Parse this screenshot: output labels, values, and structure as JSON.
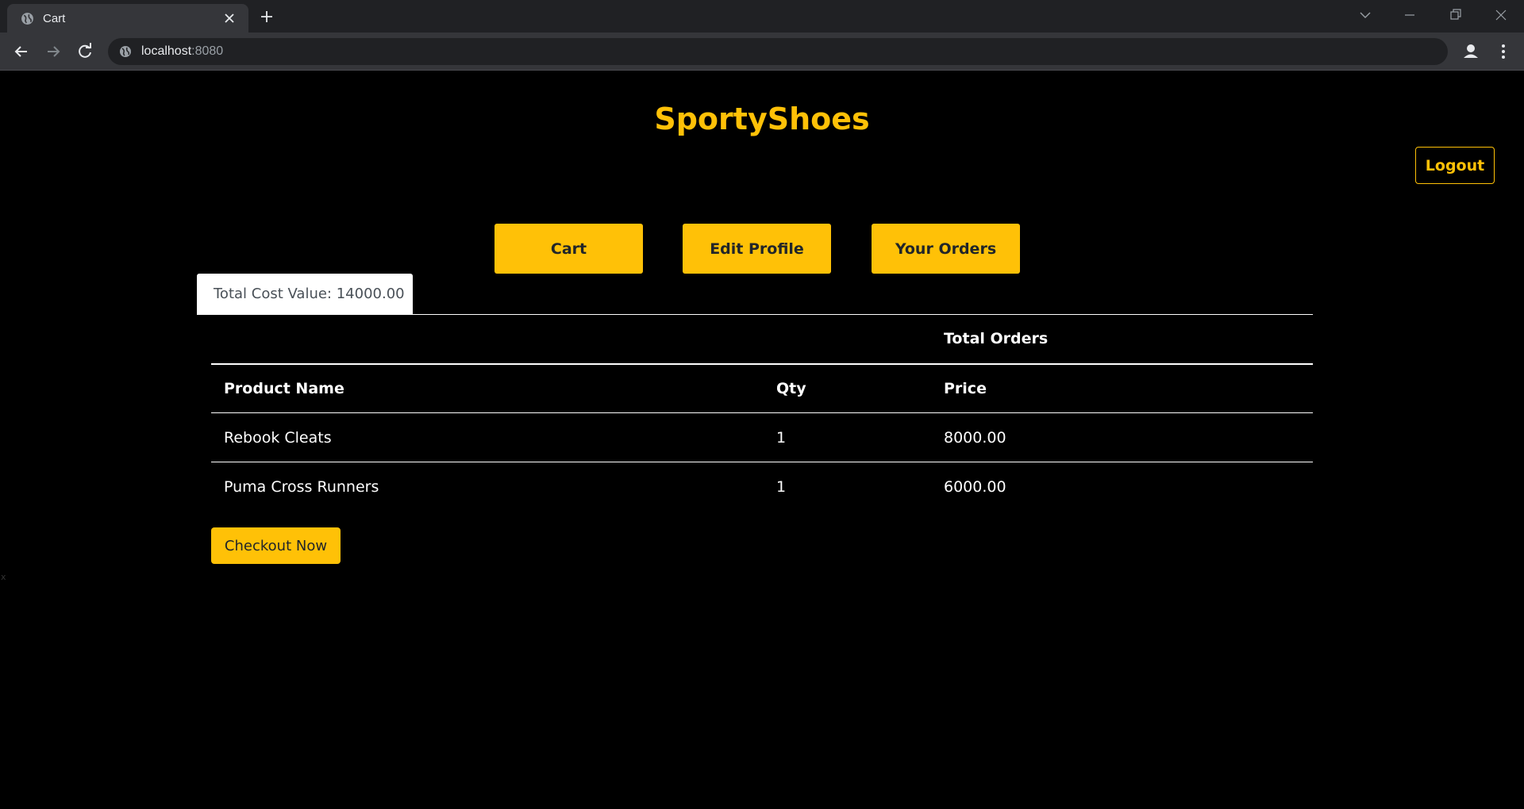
{
  "browser": {
    "tab_title": "Cart",
    "url_host": "localhost",
    "url_port": ":8080"
  },
  "header": {
    "brand": "SportyShoes",
    "logout_label": "Logout"
  },
  "nav": {
    "cart_label": "Cart",
    "edit_profile_label": "Edit Profile",
    "your_orders_label": "Your Orders"
  },
  "summary": {
    "total_cost": "Total Cost Value: 14000.00"
  },
  "table": {
    "group_header": "Total Orders",
    "columns": [
      "Product Name",
      "Qty",
      "Price"
    ],
    "rows": [
      {
        "name": "Rebook Cleats",
        "qty": "1",
        "price": "8000.00"
      },
      {
        "name": "Puma Cross Runners",
        "qty": "1",
        "price": "6000.00"
      }
    ]
  },
  "actions": {
    "checkout_label": "Checkout Now"
  },
  "stray_text": "x",
  "colors": {
    "accent": "#ffc107",
    "page_bg": "#000000",
    "text": "#ffffff",
    "button_text": "#212529"
  }
}
